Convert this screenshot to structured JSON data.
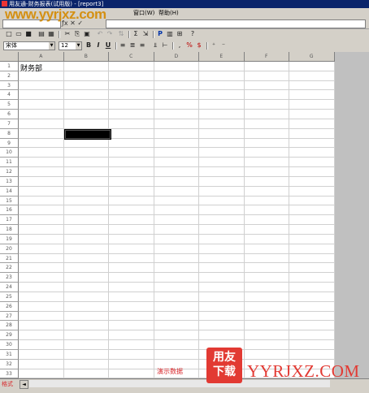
{
  "window": {
    "title": "用友通-财务报表(试用版) - [report3]"
  },
  "menubar": {
    "items": [
      {
        "label": "窗口(W)"
      },
      {
        "label": "帮助(H)"
      }
    ]
  },
  "watermark": {
    "text": "www.yyrjxz.com"
  },
  "toolbar": {
    "font_name": "宋体",
    "font_size": "12",
    "buttons": [
      "new-icon",
      "open-icon",
      "save-icon",
      "preview-icon",
      "print-icon",
      "cut-icon",
      "copy-icon",
      "paste-icon",
      "format-painter-icon",
      "merge-icon",
      "sum-icon",
      "insert-icon",
      "p-icon",
      "chart-icon",
      "zoom-icon",
      "help-icon"
    ],
    "format_buttons": [
      "B",
      "I",
      "U"
    ],
    "format_symbols": [
      "%",
      "$"
    ]
  },
  "grid": {
    "columns": [
      "A",
      "B",
      "C",
      "D",
      "E",
      "F",
      "G"
    ],
    "rows": [
      "1",
      "2",
      "3",
      "4",
      "5",
      "6",
      "7",
      "8",
      "9",
      "10",
      "11",
      "12",
      "13",
      "14",
      "15",
      "16",
      "17",
      "18",
      "19",
      "20",
      "21",
      "22",
      "23",
      "24",
      "25",
      "26",
      "27",
      "28",
      "29",
      "30",
      "31",
      "32",
      "33"
    ],
    "cell_a1": "财务部",
    "demo_label": "演示数据"
  },
  "sheet": {
    "tab_label": "格式"
  },
  "logo": {
    "chars": "用友\n下载",
    "site": "YYRJXZ.COM"
  },
  "colors": {
    "title_bg": "#0a246a",
    "accent_red": "#d9262a",
    "logo_red": "#e23a33",
    "watermark": "#d48a00"
  }
}
